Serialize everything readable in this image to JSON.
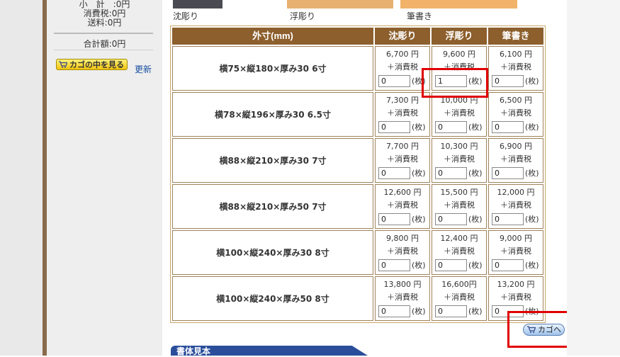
{
  "sidebar": {
    "subtotal": "小　計　:0円",
    "tax": "消費税:0円",
    "shipping": "送料:0円",
    "total": "合計額:0円",
    "view_cart_label": "カゴの中を見る",
    "update_link": "更新"
  },
  "photo_captions": [
    "沈彫り",
    "浮彫り",
    "筆書き"
  ],
  "table": {
    "headers": [
      "外寸(mm)",
      "沈彫り",
      "浮彫り",
      "筆書き"
    ],
    "tax_label": "＋消費税",
    "unit": "(枚)",
    "rows": [
      {
        "size": "横75×縦180×厚み30 6寸",
        "prices": [
          "6,700 円",
          "9,600 円",
          "6,100 円"
        ],
        "qty": [
          "0",
          "1",
          "0"
        ]
      },
      {
        "size": "横78×縦196×厚み30 6.5寸",
        "prices": [
          "7,300 円",
          "10,000 円",
          "6,500 円"
        ],
        "qty": [
          "0",
          "0",
          "0"
        ]
      },
      {
        "size": "横88×縦210×厚み30 7寸",
        "prices": [
          "7,700 円",
          "10,300 円",
          "6,900 円"
        ],
        "qty": [
          "0",
          "0",
          "0"
        ]
      },
      {
        "size": "横88×縦210×厚み50 7寸",
        "prices": [
          "12,600 円",
          "15,500 円",
          "12,000 円"
        ],
        "qty": [
          "0",
          "0",
          "0"
        ]
      },
      {
        "size": "横100×縦240×厚み30 8寸",
        "prices": [
          "9,800 円",
          "12,400 円",
          "9,000 円"
        ],
        "qty": [
          "0",
          "0",
          "0"
        ]
      },
      {
        "size": "横100×縦240×厚み50 8寸",
        "prices": [
          "13,800 円",
          "16,600円",
          "13,200 円"
        ],
        "qty": [
          "0",
          "0",
          "0"
        ]
      }
    ]
  },
  "to_cart_label": "カゴへ",
  "section_tab": "書体見本",
  "colors": {
    "header_brown": "#8c5f2d",
    "highlight_red": "#e00000",
    "button_blue": "#9fc3ec"
  }
}
